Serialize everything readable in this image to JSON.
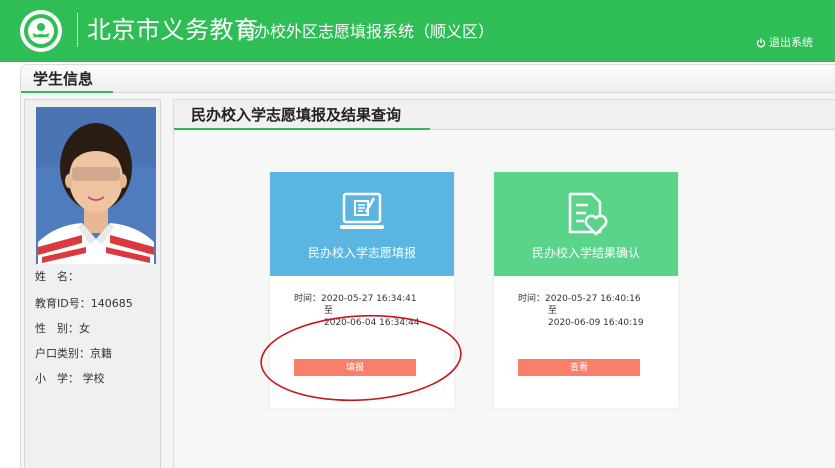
{
  "header": {
    "title": "北京市义务教育",
    "subtitle": "民办校外区志愿填报系统（顺义区）",
    "logout_label": "退出系统"
  },
  "student_section": {
    "title": "学生信息",
    "fields": [
      {
        "label": "姓　名",
        "value": "："
      },
      {
        "label": "教育ID号",
        "value": "：140685"
      },
      {
        "label": "性　别",
        "value": "：女"
      },
      {
        "label": "户口类别",
        "value": "：京籍"
      },
      {
        "label": "小　学",
        "value": "：  学校"
      }
    ]
  },
  "content_section": {
    "title": "民办校入学志愿填报及结果查询"
  },
  "cards": [
    {
      "label": "民办校入学志愿填报",
      "time_prefix": "时间：2020-05-27 16:34:41",
      "time_sep": "至",
      "time_end": "2020-06-04 16:34:44",
      "button": "填报"
    },
    {
      "label": "民办校入学结果确认",
      "time_prefix": "时间：2020-05-27 16:40:16",
      "time_sep": "至",
      "time_end": "2020-06-09 16:40:19",
      "button": "查看"
    }
  ],
  "colors": {
    "brand_green": "#2fbd56",
    "card1_blue": "#5ab6e0",
    "card2_green": "#5ad48a",
    "button_salmon": "#fa7f6a",
    "annotation_red": "#c8161d"
  }
}
